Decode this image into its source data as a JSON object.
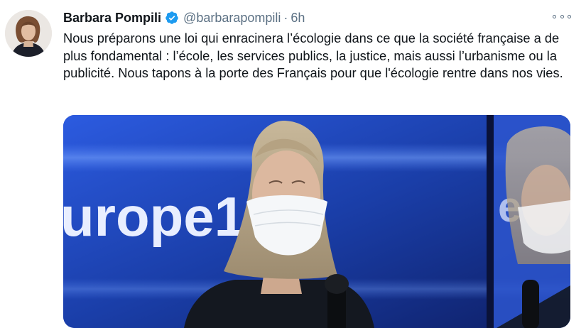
{
  "tweet": {
    "display_name": "Barbara Pompili",
    "handle": "@barbarapompili",
    "separator": "·",
    "time": "6h",
    "text": "Nous préparons une loi qui enracinera l’écologie dans ce que la société française a de plus fondamental : l’école, les services publics, la justice, mais aussi l’urbanisme ou la publicité. Nous tapons à la porte des Français pour que l'écologie rentre dans nos vies."
  },
  "media": {
    "logo_text": "urope1",
    "logo_text_reflection": "e"
  },
  "icons": {
    "verified": "verified-badge-icon",
    "more": "more-options-icon"
  },
  "colors": {
    "text": "#0f1419",
    "secondary_text": "#5b7083",
    "verified": "#1d9bf0",
    "studio_blue": "#1c3fae"
  }
}
